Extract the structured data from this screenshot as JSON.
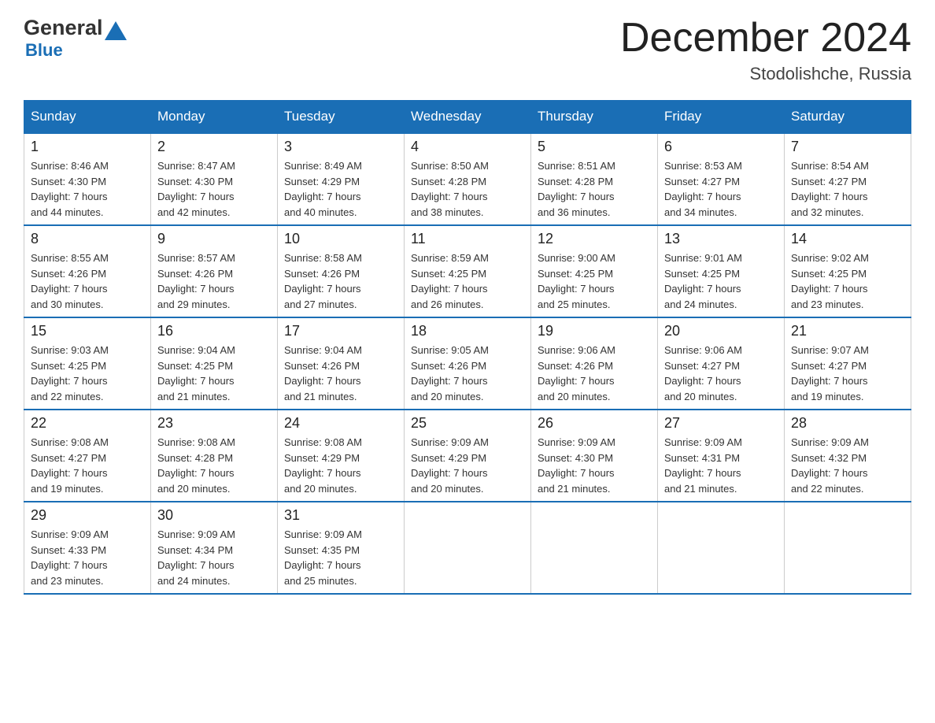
{
  "header": {
    "logo_general": "General",
    "logo_blue": "Blue",
    "title": "December 2024",
    "location": "Stodolishche, Russia"
  },
  "weekdays": [
    "Sunday",
    "Monday",
    "Tuesday",
    "Wednesday",
    "Thursday",
    "Friday",
    "Saturday"
  ],
  "weeks": [
    [
      {
        "day": "1",
        "sunrise": "8:46 AM",
        "sunset": "4:30 PM",
        "daylight": "7 hours and 44 minutes."
      },
      {
        "day": "2",
        "sunrise": "8:47 AM",
        "sunset": "4:30 PM",
        "daylight": "7 hours and 42 minutes."
      },
      {
        "day": "3",
        "sunrise": "8:49 AM",
        "sunset": "4:29 PM",
        "daylight": "7 hours and 40 minutes."
      },
      {
        "day": "4",
        "sunrise": "8:50 AM",
        "sunset": "4:28 PM",
        "daylight": "7 hours and 38 minutes."
      },
      {
        "day": "5",
        "sunrise": "8:51 AM",
        "sunset": "4:28 PM",
        "daylight": "7 hours and 36 minutes."
      },
      {
        "day": "6",
        "sunrise": "8:53 AM",
        "sunset": "4:27 PM",
        "daylight": "7 hours and 34 minutes."
      },
      {
        "day": "7",
        "sunrise": "8:54 AM",
        "sunset": "4:27 PM",
        "daylight": "7 hours and 32 minutes."
      }
    ],
    [
      {
        "day": "8",
        "sunrise": "8:55 AM",
        "sunset": "4:26 PM",
        "daylight": "7 hours and 30 minutes."
      },
      {
        "day": "9",
        "sunrise": "8:57 AM",
        "sunset": "4:26 PM",
        "daylight": "7 hours and 29 minutes."
      },
      {
        "day": "10",
        "sunrise": "8:58 AM",
        "sunset": "4:26 PM",
        "daylight": "7 hours and 27 minutes."
      },
      {
        "day": "11",
        "sunrise": "8:59 AM",
        "sunset": "4:25 PM",
        "daylight": "7 hours and 26 minutes."
      },
      {
        "day": "12",
        "sunrise": "9:00 AM",
        "sunset": "4:25 PM",
        "daylight": "7 hours and 25 minutes."
      },
      {
        "day": "13",
        "sunrise": "9:01 AM",
        "sunset": "4:25 PM",
        "daylight": "7 hours and 24 minutes."
      },
      {
        "day": "14",
        "sunrise": "9:02 AM",
        "sunset": "4:25 PM",
        "daylight": "7 hours and 23 minutes."
      }
    ],
    [
      {
        "day": "15",
        "sunrise": "9:03 AM",
        "sunset": "4:25 PM",
        "daylight": "7 hours and 22 minutes."
      },
      {
        "day": "16",
        "sunrise": "9:04 AM",
        "sunset": "4:25 PM",
        "daylight": "7 hours and 21 minutes."
      },
      {
        "day": "17",
        "sunrise": "9:04 AM",
        "sunset": "4:26 PM",
        "daylight": "7 hours and 21 minutes."
      },
      {
        "day": "18",
        "sunrise": "9:05 AM",
        "sunset": "4:26 PM",
        "daylight": "7 hours and 20 minutes."
      },
      {
        "day": "19",
        "sunrise": "9:06 AM",
        "sunset": "4:26 PM",
        "daylight": "7 hours and 20 minutes."
      },
      {
        "day": "20",
        "sunrise": "9:06 AM",
        "sunset": "4:27 PM",
        "daylight": "7 hours and 20 minutes."
      },
      {
        "day": "21",
        "sunrise": "9:07 AM",
        "sunset": "4:27 PM",
        "daylight": "7 hours and 19 minutes."
      }
    ],
    [
      {
        "day": "22",
        "sunrise": "9:08 AM",
        "sunset": "4:27 PM",
        "daylight": "7 hours and 19 minutes."
      },
      {
        "day": "23",
        "sunrise": "9:08 AM",
        "sunset": "4:28 PM",
        "daylight": "7 hours and 20 minutes."
      },
      {
        "day": "24",
        "sunrise": "9:08 AM",
        "sunset": "4:29 PM",
        "daylight": "7 hours and 20 minutes."
      },
      {
        "day": "25",
        "sunrise": "9:09 AM",
        "sunset": "4:29 PM",
        "daylight": "7 hours and 20 minutes."
      },
      {
        "day": "26",
        "sunrise": "9:09 AM",
        "sunset": "4:30 PM",
        "daylight": "7 hours and 21 minutes."
      },
      {
        "day": "27",
        "sunrise": "9:09 AM",
        "sunset": "4:31 PM",
        "daylight": "7 hours and 21 minutes."
      },
      {
        "day": "28",
        "sunrise": "9:09 AM",
        "sunset": "4:32 PM",
        "daylight": "7 hours and 22 minutes."
      }
    ],
    [
      {
        "day": "29",
        "sunrise": "9:09 AM",
        "sunset": "4:33 PM",
        "daylight": "7 hours and 23 minutes."
      },
      {
        "day": "30",
        "sunrise": "9:09 AM",
        "sunset": "4:34 PM",
        "daylight": "7 hours and 24 minutes."
      },
      {
        "day": "31",
        "sunrise": "9:09 AM",
        "sunset": "4:35 PM",
        "daylight": "7 hours and 25 minutes."
      },
      null,
      null,
      null,
      null
    ]
  ],
  "labels": {
    "sunrise": "Sunrise:",
    "sunset": "Sunset:",
    "daylight": "Daylight:"
  }
}
